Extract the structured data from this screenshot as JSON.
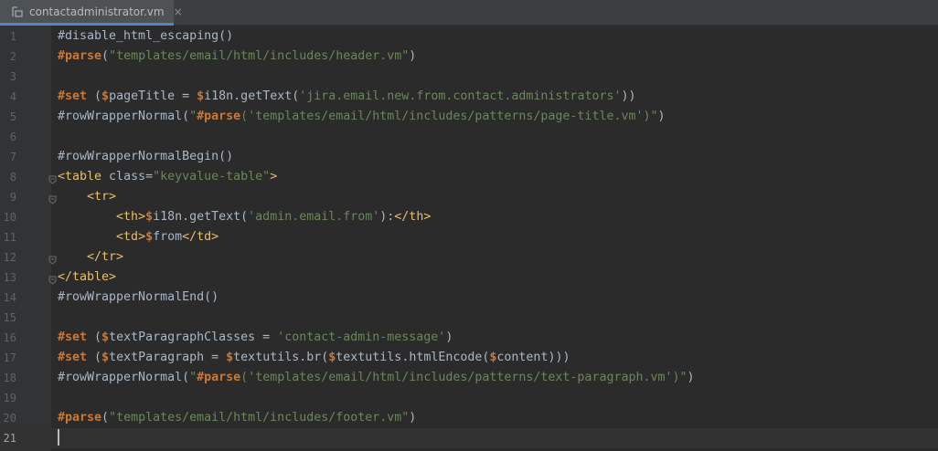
{
  "tab": {
    "filename": "contactadministrator.vm",
    "close": "×"
  },
  "lines": [
    {
      "num": "1",
      "segments": [
        {
          "c": "m",
          "t": "#disable_html_escaping()"
        }
      ]
    },
    {
      "num": "2",
      "segments": [
        {
          "c": "k",
          "t": "#parse"
        },
        {
          "c": "m",
          "t": "("
        },
        {
          "c": "s",
          "t": "\"templates/email/html/includes/header.vm\""
        },
        {
          "c": "m",
          "t": ")"
        }
      ]
    },
    {
      "num": "3",
      "segments": []
    },
    {
      "num": "4",
      "segments": [
        {
          "c": "k",
          "t": "#set"
        },
        {
          "c": "m",
          "t": " ("
        },
        {
          "c": "k",
          "t": "$"
        },
        {
          "c": "m",
          "t": "pageTitle = "
        },
        {
          "c": "k",
          "t": "$"
        },
        {
          "c": "m",
          "t": "i18n.getText("
        },
        {
          "c": "s",
          "t": "'jira.email.new.from.contact.administrators'"
        },
        {
          "c": "m",
          "t": "))"
        }
      ]
    },
    {
      "num": "5",
      "segments": [
        {
          "c": "m",
          "t": "#rowWrapperNormal("
        },
        {
          "c": "s",
          "t": "\""
        },
        {
          "c": "k",
          "t": "#parse"
        },
        {
          "c": "s",
          "t": "("
        },
        {
          "c": "s",
          "t": "'templates/email/html/includes/patterns/page-title.vm'"
        },
        {
          "c": "s",
          "t": ")\""
        },
        {
          "c": "m",
          "t": ")"
        }
      ]
    },
    {
      "num": "6",
      "segments": []
    },
    {
      "num": "7",
      "segments": [
        {
          "c": "m",
          "t": "#rowWrapperNormalBegin()"
        }
      ]
    },
    {
      "num": "8",
      "segments": [
        {
          "c": "t",
          "t": "<table"
        },
        {
          "c": "m",
          "t": " class="
        },
        {
          "c": "s",
          "t": "\"keyvalue-table\""
        },
        {
          "c": "t",
          "t": ">"
        }
      ]
    },
    {
      "num": "9",
      "segments": [
        {
          "c": "m",
          "t": "    "
        },
        {
          "c": "t",
          "t": "<tr>"
        }
      ]
    },
    {
      "num": "10",
      "segments": [
        {
          "c": "m",
          "t": "        "
        },
        {
          "c": "t",
          "t": "<th>"
        },
        {
          "c": "k",
          "t": "$"
        },
        {
          "c": "m",
          "t": "i18n.getText("
        },
        {
          "c": "s",
          "t": "'admin.email.from'"
        },
        {
          "c": "m",
          "t": "):"
        },
        {
          "c": "t",
          "t": "</th>"
        }
      ]
    },
    {
      "num": "11",
      "segments": [
        {
          "c": "m",
          "t": "        "
        },
        {
          "c": "t",
          "t": "<td>"
        },
        {
          "c": "k",
          "t": "$"
        },
        {
          "c": "m",
          "t": "from"
        },
        {
          "c": "t",
          "t": "</td>"
        }
      ]
    },
    {
      "num": "12",
      "segments": [
        {
          "c": "m",
          "t": "    "
        },
        {
          "c": "t",
          "t": "</tr>"
        }
      ]
    },
    {
      "num": "13",
      "segments": [
        {
          "c": "t",
          "t": "</table>"
        }
      ]
    },
    {
      "num": "14",
      "segments": [
        {
          "c": "m",
          "t": "#rowWrapperNormalEnd()"
        }
      ]
    },
    {
      "num": "15",
      "segments": []
    },
    {
      "num": "16",
      "segments": [
        {
          "c": "k",
          "t": "#set"
        },
        {
          "c": "m",
          "t": " ("
        },
        {
          "c": "k",
          "t": "$"
        },
        {
          "c": "m",
          "t": "textParagraphClasses = "
        },
        {
          "c": "s",
          "t": "'contact-admin-message'"
        },
        {
          "c": "m",
          "t": ")"
        }
      ]
    },
    {
      "num": "17",
      "segments": [
        {
          "c": "k",
          "t": "#set"
        },
        {
          "c": "m",
          "t": " ("
        },
        {
          "c": "k",
          "t": "$"
        },
        {
          "c": "m",
          "t": "textParagraph = "
        },
        {
          "c": "k",
          "t": "$"
        },
        {
          "c": "m",
          "t": "textutils.br("
        },
        {
          "c": "k",
          "t": "$"
        },
        {
          "c": "m",
          "t": "textutils.htmlEncode("
        },
        {
          "c": "k",
          "t": "$"
        },
        {
          "c": "m",
          "t": "content)))"
        }
      ]
    },
    {
      "num": "18",
      "segments": [
        {
          "c": "m",
          "t": "#rowWrapperNormal("
        },
        {
          "c": "s",
          "t": "\""
        },
        {
          "c": "k",
          "t": "#parse"
        },
        {
          "c": "s",
          "t": "("
        },
        {
          "c": "s",
          "t": "'templates/email/html/includes/patterns/text-paragraph.vm'"
        },
        {
          "c": "s",
          "t": ")\""
        },
        {
          "c": "m",
          "t": ")"
        }
      ]
    },
    {
      "num": "19",
      "segments": []
    },
    {
      "num": "20",
      "segments": [
        {
          "c": "k",
          "t": "#parse"
        },
        {
          "c": "m",
          "t": "("
        },
        {
          "c": "s",
          "t": "\"templates/email/html/includes/footer.vm\""
        },
        {
          "c": "m",
          "t": ")"
        }
      ]
    },
    {
      "num": "21",
      "segments": []
    }
  ],
  "current_line": "21",
  "fold_markers": [
    "8",
    "9",
    "12",
    "13"
  ],
  "colors": {
    "keyword": "#cc7832",
    "string": "#6a8759",
    "tag": "#e8bf6a",
    "plain": "#a9b7c6",
    "background": "#2b2b2b"
  }
}
